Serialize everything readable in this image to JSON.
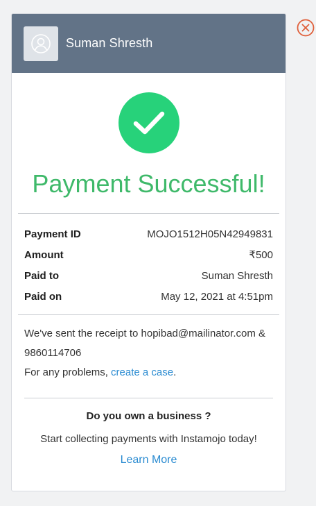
{
  "header": {
    "name": "Suman Shresth",
    "avatar_icon": "user-avatar-icon"
  },
  "status": {
    "title": "Payment Successful!",
    "icon": "checkmark-icon",
    "color": "#27d27a"
  },
  "details": [
    {
      "label": "Payment ID",
      "value": "MOJO1512H05N42949831"
    },
    {
      "label": "Amount",
      "value": "₹500"
    },
    {
      "label": "Paid to",
      "value": "Suman Shresth"
    },
    {
      "label": "Paid on",
      "value": "May 12, 2021 at 4:51pm"
    }
  ],
  "receipt": {
    "line1": "We've sent the receipt to hopibad@mailinator.com & 9860114706",
    "problems_prefix": "For any problems, ",
    "problems_link": "create a case",
    "problems_suffix": "."
  },
  "business": {
    "question": "Do you own a business ?",
    "pitch": "Start collecting payments with Instamojo today!",
    "learn_more": "Learn More"
  },
  "close": {
    "icon": "close-circle-icon",
    "color": "#e0603b"
  }
}
